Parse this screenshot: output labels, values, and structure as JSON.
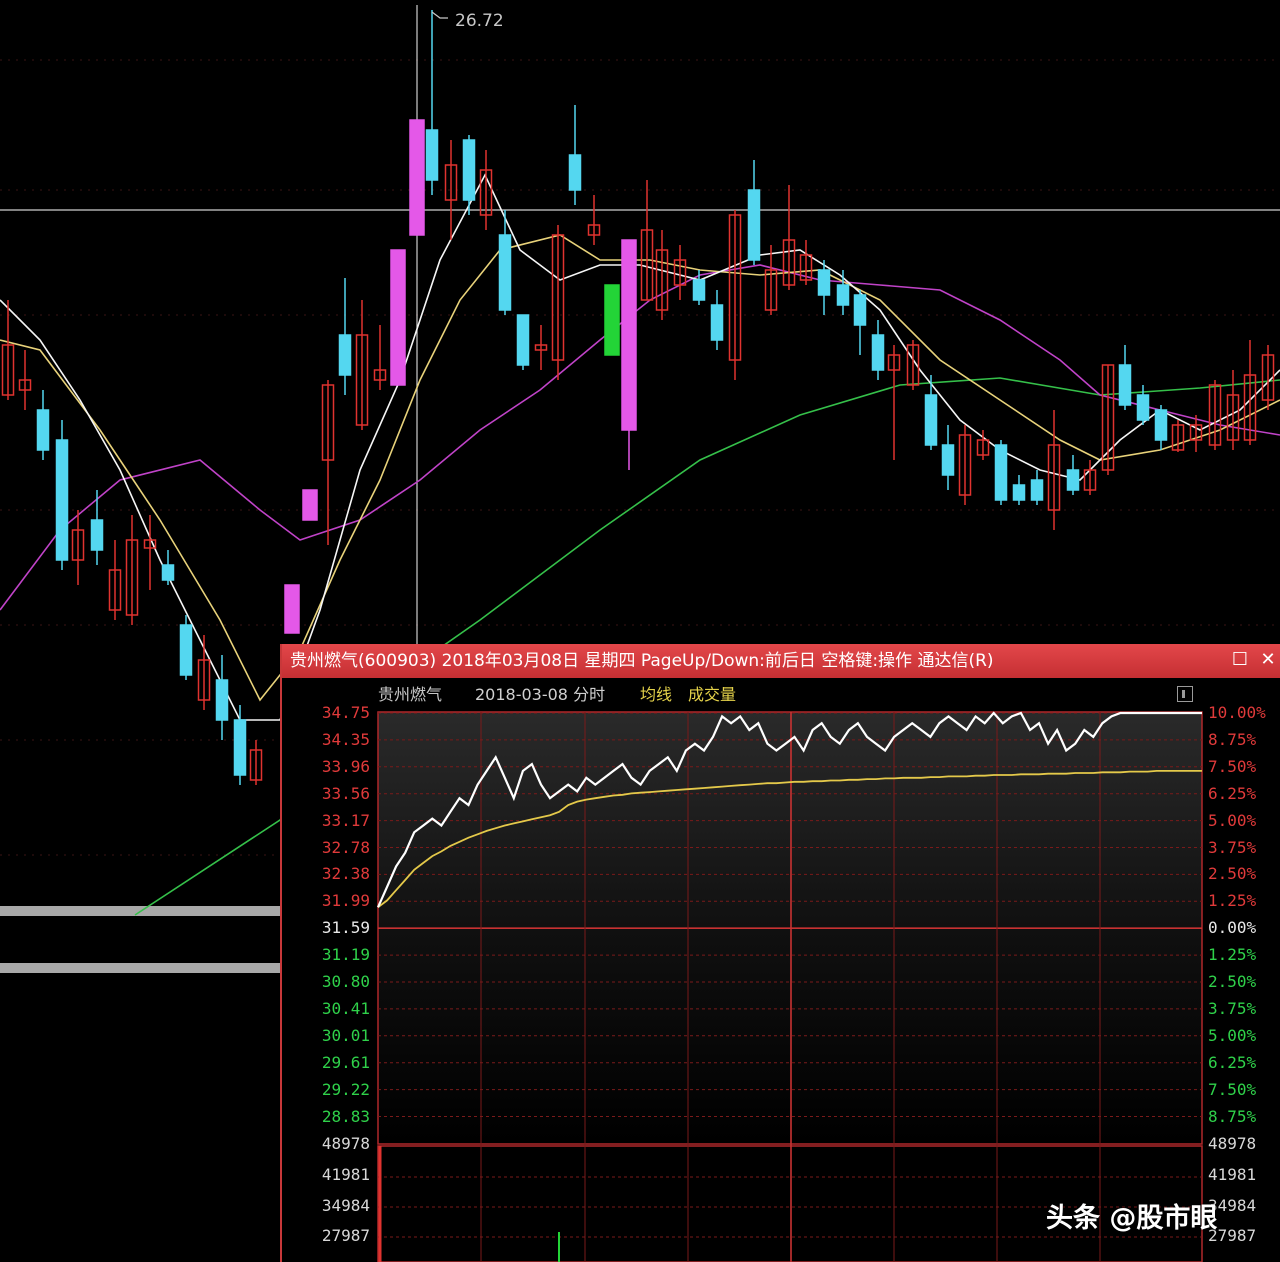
{
  "kline": {
    "peak_label": "26.72",
    "colors": {
      "up": "#e0332f",
      "down": "#54d7f0",
      "limit_up": "#e458e8",
      "limit_down": "#23d437",
      "ma5": "#ffffff",
      "ma10": "#e8d27a",
      "ma20": "#c043c8",
      "ma60": "#35c04a",
      "crosshair": "#cfcfcf"
    }
  },
  "window": {
    "title": "贵州燃气(600903) 2018年03月08日 星期四 PageUp/Down:前后日 空格键:操作 通达信(R)",
    "maximize_icon": "maximize-icon",
    "close_icon": "close-icon",
    "color": "#d13c3f"
  },
  "subheader": {
    "stock_name": "贵州燃气",
    "date_mode": "2018-03-08 分时",
    "avg_line": "均线",
    "volume": "成交量"
  },
  "price_axis": {
    "left": [
      "34.75",
      "34.35",
      "33.96",
      "33.56",
      "33.17",
      "32.78",
      "32.38",
      "31.99",
      "31.59",
      "31.19",
      "30.80",
      "30.41",
      "30.01",
      "29.61",
      "29.22",
      "28.83"
    ],
    "right": [
      "10.00%",
      "8.75%",
      "7.50%",
      "6.25%",
      "5.00%",
      "3.75%",
      "2.50%",
      "1.25%",
      "0.00%",
      "1.25%",
      "2.50%",
      "3.75%",
      "5.00%",
      "6.25%",
      "7.50%",
      "8.75%"
    ]
  },
  "volume_axis": {
    "left": [
      "48978",
      "41981",
      "34984",
      "27987"
    ],
    "right": [
      "48978",
      "41981",
      "34984",
      "27987"
    ]
  },
  "intraday": {
    "prev_close": 31.59,
    "price_range": [
      28.43,
      34.75
    ],
    "price": [
      31.9,
      32.2,
      32.5,
      32.7,
      33.0,
      33.1,
      33.2,
      33.1,
      33.3,
      33.5,
      33.4,
      33.7,
      33.9,
      34.1,
      33.8,
      33.5,
      33.9,
      34.0,
      33.7,
      33.5,
      33.6,
      33.7,
      33.6,
      33.8,
      33.7,
      33.8,
      33.9,
      34.0,
      33.8,
      33.7,
      33.9,
      34.0,
      34.1,
      33.9,
      34.2,
      34.3,
      34.2,
      34.4,
      34.7,
      34.6,
      34.7,
      34.5,
      34.6,
      34.3,
      34.2,
      34.3,
      34.4,
      34.2,
      34.5,
      34.6,
      34.4,
      34.3,
      34.5,
      34.6,
      34.4,
      34.3,
      34.2,
      34.4,
      34.5,
      34.6,
      34.5,
      34.4,
      34.6,
      34.7,
      34.6,
      34.5,
      34.7,
      34.6,
      34.75,
      34.6,
      34.7,
      34.75,
      34.5,
      34.6,
      34.3,
      34.5,
      34.2,
      34.3,
      34.5,
      34.4,
      34.6,
      34.7,
      34.75,
      34.75,
      34.75,
      34.75,
      34.75,
      34.75,
      34.75,
      34.75,
      34.75,
      34.75
    ],
    "avg": [
      31.9,
      32.0,
      32.15,
      32.3,
      32.45,
      32.55,
      32.65,
      32.72,
      32.8,
      32.86,
      32.92,
      32.97,
      33.02,
      33.06,
      33.1,
      33.13,
      33.16,
      33.19,
      33.22,
      33.25,
      33.3,
      33.4,
      33.45,
      33.48,
      33.5,
      33.52,
      33.54,
      33.55,
      33.57,
      33.58,
      33.59,
      33.6,
      33.61,
      33.62,
      33.63,
      33.64,
      33.65,
      33.66,
      33.67,
      33.68,
      33.69,
      33.7,
      33.71,
      33.72,
      33.72,
      33.73,
      33.74,
      33.74,
      33.75,
      33.75,
      33.76,
      33.76,
      33.77,
      33.77,
      33.78,
      33.78,
      33.79,
      33.79,
      33.8,
      33.8,
      33.8,
      33.81,
      33.81,
      33.82,
      33.82,
      33.82,
      33.83,
      33.83,
      33.84,
      33.84,
      33.84,
      33.85,
      33.85,
      33.85,
      33.86,
      33.86,
      33.86,
      33.87,
      33.87,
      33.87,
      33.88,
      33.88,
      33.88,
      33.89,
      33.89,
      33.89,
      33.9,
      33.9,
      33.9,
      33.9,
      33.9,
      33.9
    ]
  },
  "watermark": "头条 @股市眼"
}
